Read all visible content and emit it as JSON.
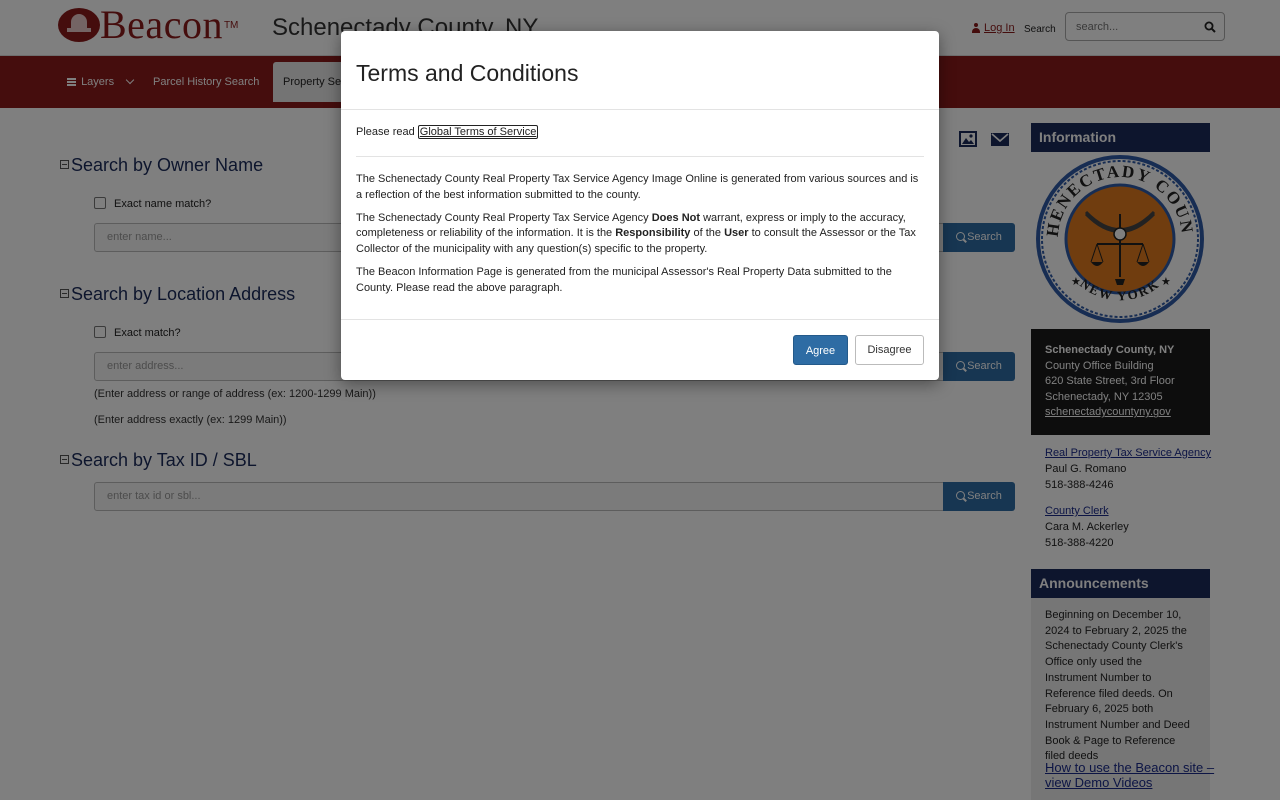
{
  "header": {
    "brand": "Beacon",
    "brand_tm": "TM",
    "county_title": "Schenectady County, NY",
    "login_label": "Log In",
    "search_label": "Search",
    "search_placeholder": "search..."
  },
  "nav": {
    "layers_label": "Layers",
    "parcel_history_label": "Parcel History Search",
    "property_search_label": "Property Search"
  },
  "search": {
    "owner": {
      "title": "Search by Owner Name",
      "exact_label": "Exact name match?",
      "placeholder": "enter name...",
      "button": "Search"
    },
    "location": {
      "title": "Search by Location Address",
      "exact_label": "Exact match?",
      "placeholder": "enter address...",
      "button": "Search",
      "hint_range": "(Enter address or range of address (ex: 1200-1299 Main))",
      "hint_exact": "(Enter address exactly (ex: 1299 Main))"
    },
    "taxid": {
      "title": "Search by Tax ID / SBL",
      "placeholder": "enter tax id or sbl...",
      "button": "Search"
    }
  },
  "sidebar": {
    "info_title": "Information",
    "seal_top": "SCHENECTADY COUNTY",
    "seal_bottom": "NEW YORK",
    "address": {
      "name": "Schenectady County, NY",
      "building": "County Office Building",
      "street": "620 State Street, 3rd Floor",
      "city": "Schenectady, NY 12305",
      "website": "schenectadycountyny.gov"
    },
    "contacts": [
      {
        "dept": "Real Property Tax Service Agency",
        "person": "Paul G. Romano",
        "phone": "518-388-4246"
      },
      {
        "dept": "County Clerk",
        "person": "Cara M. Ackerley",
        "phone": "518-388-4220"
      }
    ],
    "announcements_title": "Announcements",
    "announcement_text": "Beginning on December 10, 2024 to February 2, 2025 the Schenectady County Clerk's Office only used the Instrument Number to Reference filed deeds. On February 6, 2025 both Instrument Number and Deed Book & Page to Reference filed deeds",
    "demo_link": "How to use the Beacon site – view Demo Videos"
  },
  "modal": {
    "title": "Terms and Conditions",
    "read_prefix": "Please read ",
    "tos_link": "Global Terms of Service",
    "para1": "The Schenectady County Real Property Tax Service Agency Image Online is generated from various sources and is a reflection of the best information submitted to the county.",
    "para2_a": "The Schenectady County Real Property Tax Service Agency ",
    "para2_bold1": "Does Not",
    "para2_b": " warrant, express or imply to the accuracy, completeness or reliability of the information.  It is the ",
    "para2_bold2": "Responsibility",
    "para2_c": " of the ",
    "para2_bold3": "User",
    "para2_d": " to consult the Assessor or the Tax Collector of the municipality with any question(s) specific to the property.",
    "para3": "The Beacon Information Page is generated from the municipal Assessor's Real Property Data submitted to the County. Please read the above paragraph.",
    "agree": "Agree",
    "disagree": "Disagree"
  },
  "colors": {
    "brand_red": "#8b1a1a",
    "navy": "#1a2a5a",
    "button_blue": "#2e6ca4",
    "seal_orange": "#e07b1e"
  }
}
